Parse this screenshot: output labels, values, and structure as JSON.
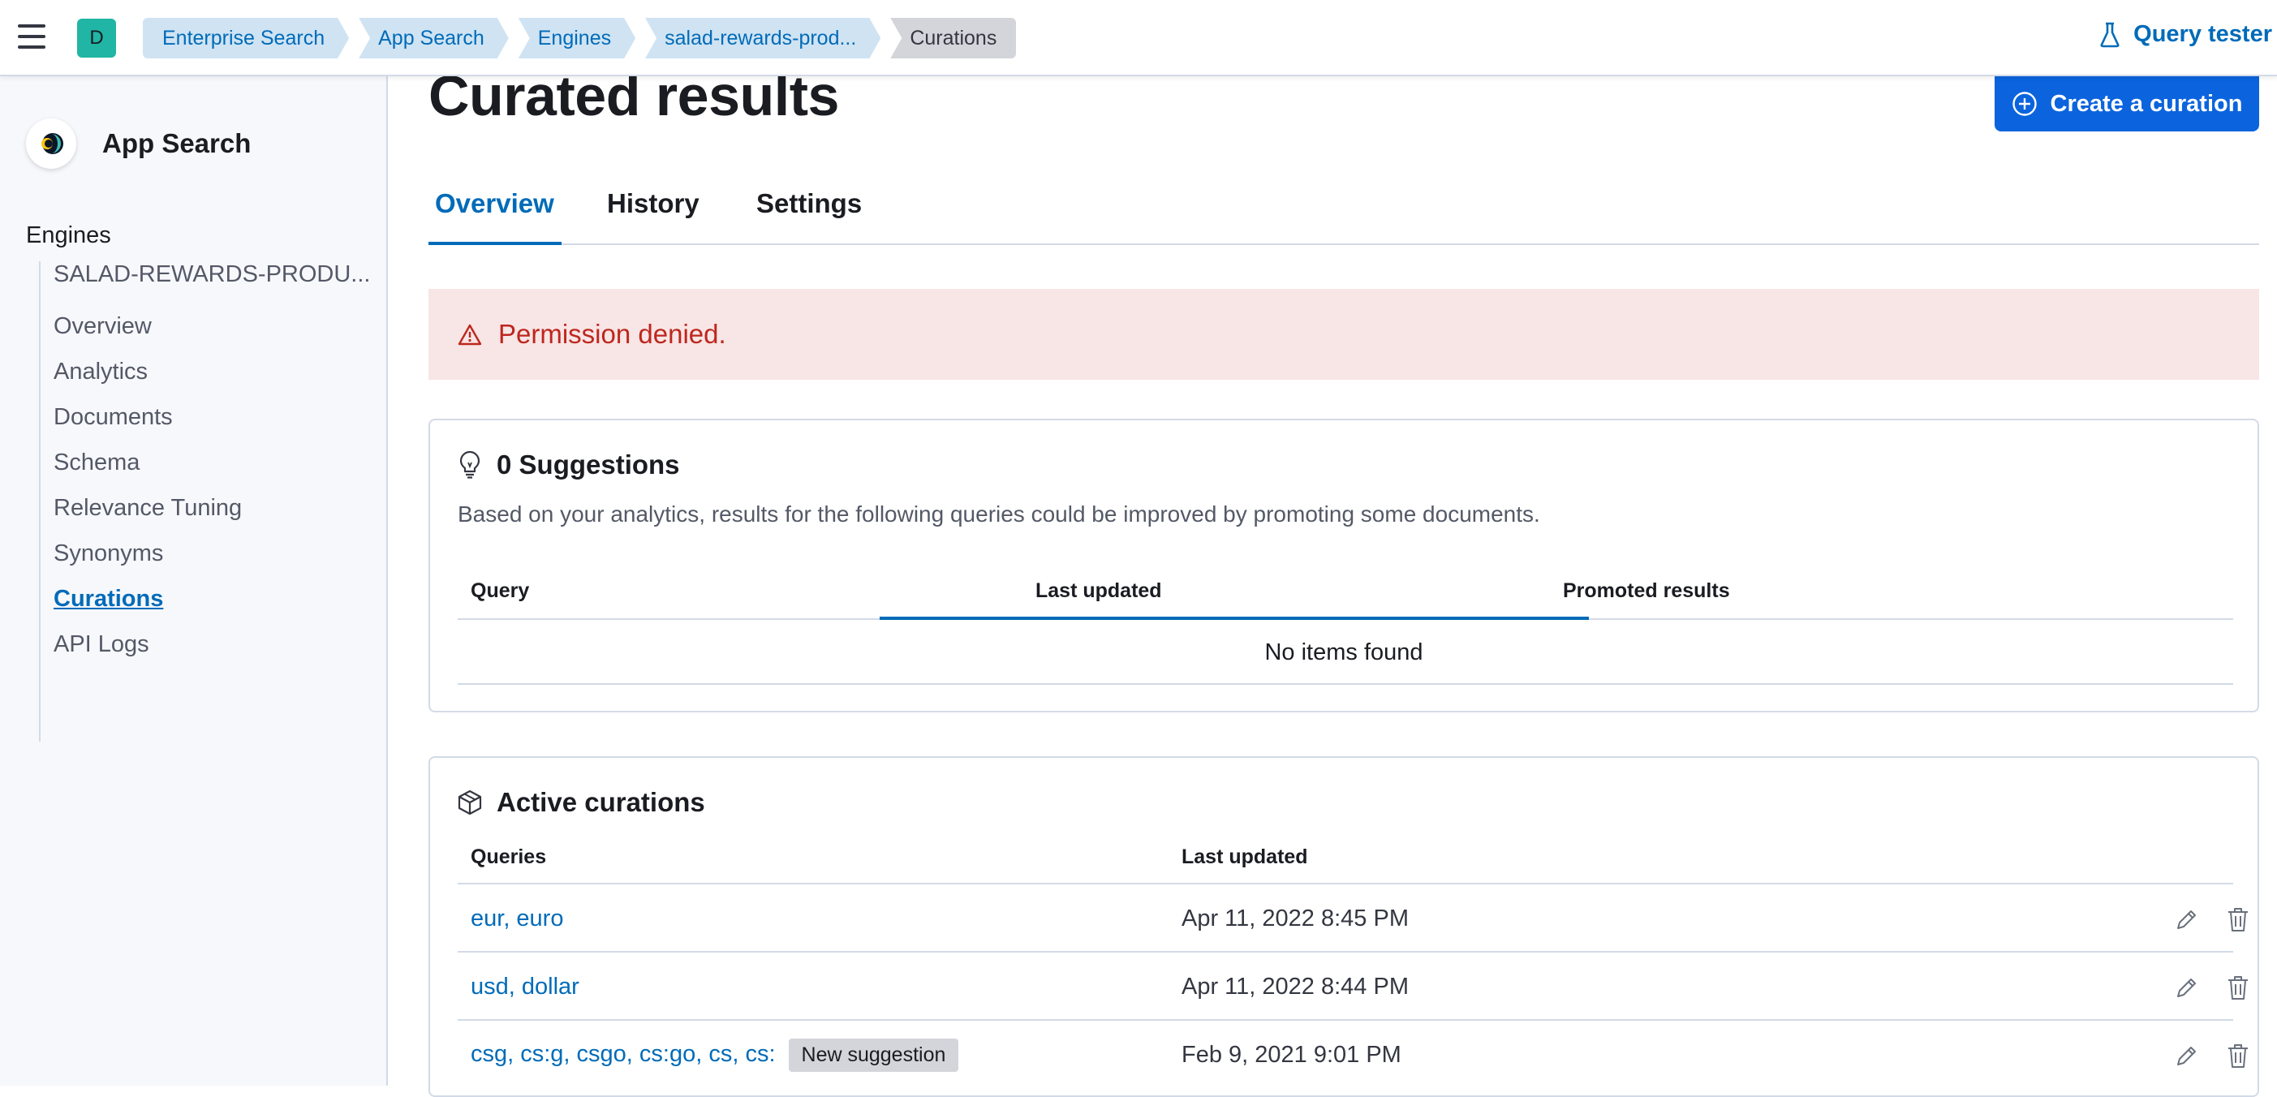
{
  "header": {
    "space_initial": "D",
    "breadcrumbs": [
      "Enterprise Search",
      "App Search",
      "Engines",
      "salad-rewards-prod...",
      "Curations"
    ],
    "query_tester": "Query tester"
  },
  "sidebar": {
    "brand": "App Search",
    "heading": "Engines",
    "engine": "SALAD-REWARDS-PRODU...",
    "items": [
      "Overview",
      "Analytics",
      "Documents",
      "Schema",
      "Relevance Tuning",
      "Synonyms",
      "Curations",
      "API Logs"
    ],
    "active_item": "Curations"
  },
  "main": {
    "title": "Curated results",
    "create_button": "Create a curation",
    "tabs": [
      "Overview",
      "History",
      "Settings"
    ],
    "active_tab": "Overview",
    "error": "Permission denied.",
    "suggestions": {
      "title": "0 Suggestions",
      "description": "Based on your analytics, results for the following queries could be improved by promoting some documents.",
      "columns": [
        "Query",
        "Last updated",
        "Promoted results"
      ],
      "empty": "No items found"
    },
    "active_curations": {
      "title": "Active curations",
      "columns": [
        "Queries",
        "Last updated"
      ],
      "rows": [
        {
          "queries": "eur, euro",
          "updated": "Apr 11, 2022 8:45 PM",
          "badge": ""
        },
        {
          "queries": "usd, dollar",
          "updated": "Apr 11, 2022 8:44 PM",
          "badge": ""
        },
        {
          "queries": "csg, cs:g, csgo, cs:go, cs, cs:",
          "updated": "Feb 9, 2021 9:01 PM",
          "badge": "New suggestion"
        }
      ]
    }
  },
  "colors": {
    "accent": "#006bb8",
    "primary_button": "#0b64dd",
    "danger": "#bd271e",
    "danger_bg": "#f8e5e5",
    "space_badge": "#20b5a4"
  }
}
